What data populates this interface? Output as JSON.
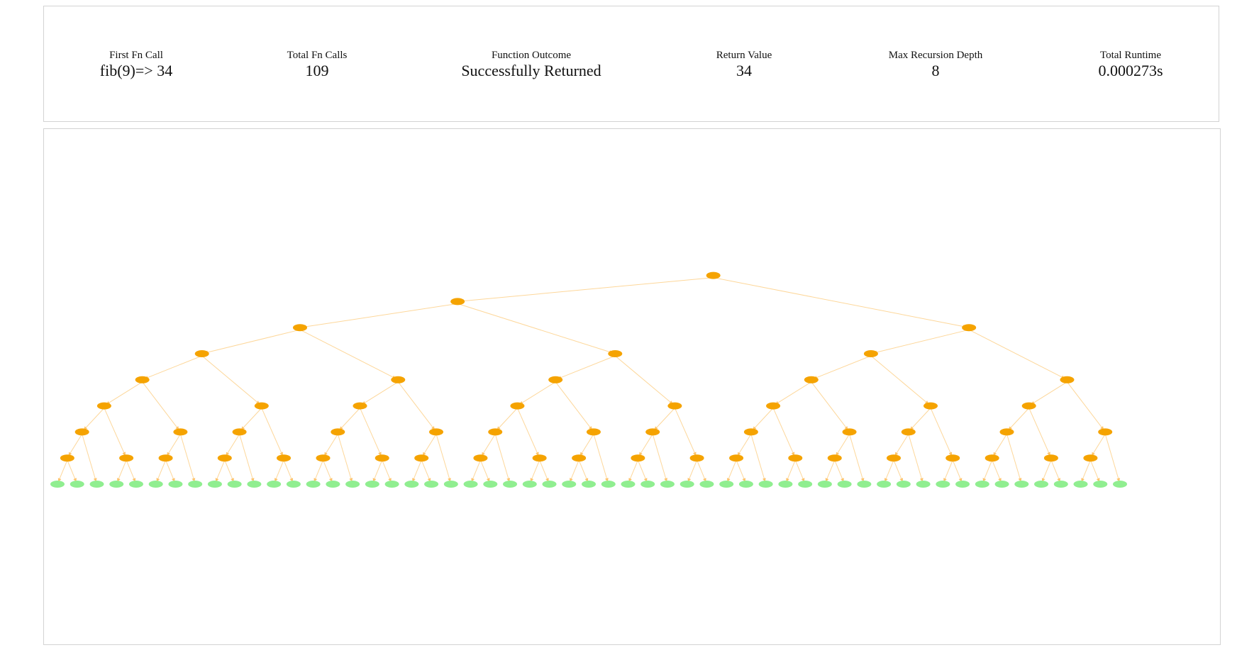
{
  "stats": {
    "first_call": {
      "label": "First Fn Call",
      "value": "fib(9)=> 34"
    },
    "total_calls": {
      "label": "Total Fn Calls",
      "value": "109"
    },
    "outcome": {
      "label": "Function Outcome",
      "value": "Successfully Returned"
    },
    "return_value": {
      "label": "Return Value",
      "value": "34"
    },
    "max_depth": {
      "label": "Max Recursion Depth",
      "value": "8"
    },
    "runtime": {
      "label": "Total Runtime",
      "value": "0.000273s"
    }
  },
  "tree": {
    "root_n": 9,
    "internal_color": "#f5a300",
    "leaf_color": "#90ee90",
    "edge_color": "#fdd79a"
  }
}
